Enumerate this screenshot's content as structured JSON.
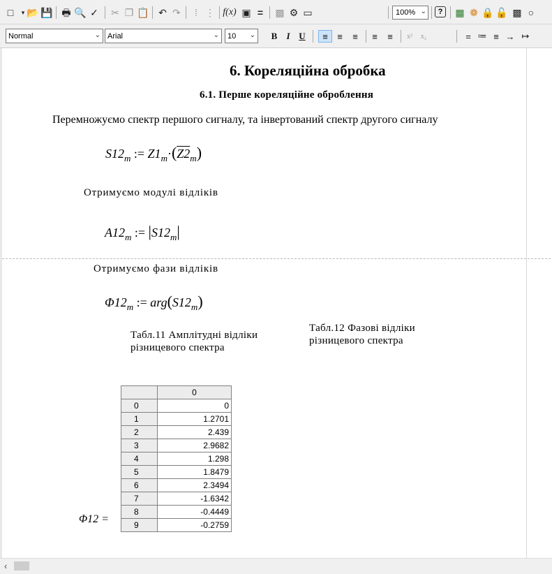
{
  "toolbar": {
    "zoom": "100%"
  },
  "format_bar": {
    "style": "Normal",
    "font": "Arial",
    "size": "10",
    "bold": "B",
    "italic": "I",
    "underline": "U"
  },
  "document": {
    "heading": "6. Кореляційна обробка",
    "subheading": "6.1. Перше кореляційне оброблення",
    "intro": "Перемножуємо спектр першого сигналу, та інвертований спектр другого сигналу",
    "eq1": {
      "lhs": "S12",
      "sub": "m",
      "assign": ":=",
      "a": "Z1",
      "a_sub": "m",
      "b": "Z2",
      "b_sub": "m"
    },
    "modules_text": "Отримуємо модулі відліків",
    "eq2": {
      "lhs": "A12",
      "sub": "m",
      "assign": ":=",
      "arg": "S12",
      "arg_sub": "m"
    },
    "phases_text": "Отримуємо фази відліків",
    "eq3": {
      "lhs": "Φ12",
      "sub": "m",
      "assign": ":=",
      "fn": "arg",
      "arg": "S12",
      "arg_sub": "m"
    },
    "caption11": "Табл.11    Амплітудні відліки    різницевого спектра",
    "caption12": "Табл.12     Фазові відліки різницевого спектра",
    "result_label": "Φ12 ="
  },
  "table": {
    "column_header": "0",
    "rows": [
      {
        "index": "0",
        "value": "0"
      },
      {
        "index": "1",
        "value": "1.2701"
      },
      {
        "index": "2",
        "value": "2.439"
      },
      {
        "index": "3",
        "value": "2.9682"
      },
      {
        "index": "4",
        "value": "1.298"
      },
      {
        "index": "5",
        "value": "1.8479"
      },
      {
        "index": "6",
        "value": "2.3494"
      },
      {
        "index": "7",
        "value": "-1.6342"
      },
      {
        "index": "8",
        "value": "-0.4449"
      },
      {
        "index": "9",
        "value": "-0.2759"
      }
    ]
  }
}
